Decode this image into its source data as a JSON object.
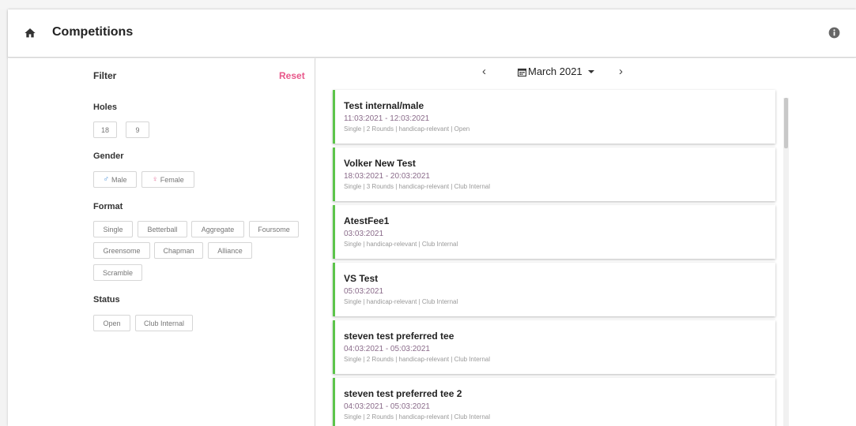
{
  "header": {
    "title": "Competitions",
    "home_icon": "home-icon",
    "info_icon": "info-icon"
  },
  "filter": {
    "title": "Filter",
    "reset_label": "Reset",
    "holes": {
      "label": "Holes",
      "options": [
        "18",
        "9"
      ]
    },
    "gender": {
      "label": "Gender",
      "options": [
        "Male",
        "Female"
      ],
      "icons": [
        "male-symbol-icon",
        "female-symbol-icon"
      ]
    },
    "format": {
      "label": "Format",
      "options": [
        "Single",
        "Betterball",
        "Aggregate",
        "Foursome",
        "Greensome",
        "Chapman",
        "Alliance",
        "Scramble"
      ]
    },
    "status": {
      "label": "Status",
      "options": [
        "Open",
        "Club Internal"
      ]
    }
  },
  "calendar": {
    "month_label": "March 2021",
    "prev_symbol": "‹",
    "next_symbol": "›",
    "calendar_icon": "calendar-icon",
    "caret_icon": "caret-down-icon"
  },
  "competitions": [
    {
      "title": "Test internal/male",
      "dates": "11:03:2021 - 12:03:2021",
      "meta": "Single | 2 Rounds | handicap-relevant | Open"
    },
    {
      "title": "Volker New Test",
      "dates": "18:03:2021 - 20:03:2021",
      "meta": "Single | 3 Rounds | handicap-relevant | Club Internal"
    },
    {
      "title": "AtestFee1",
      "dates": "03:03:2021",
      "meta": "Single | handicap-relevant | Club Internal"
    },
    {
      "title": "VS Test",
      "dates": "05:03:2021",
      "meta": "Single | handicap-relevant | Club Internal"
    },
    {
      "title": "steven test preferred tee",
      "dates": "04:03:2021 - 05:03:2021",
      "meta": "Single | 2 Rounds | handicap-relevant | Club Internal"
    },
    {
      "title": "steven test preferred tee 2",
      "dates": "04:03:2021 - 05:03:2021",
      "meta": "Single | 2 Rounds | handicap-relevant | Club Internal"
    }
  ],
  "colors": {
    "accent_pink": "#e8578a",
    "card_border_green": "#5cc44a",
    "male_blue": "#4a90d9",
    "female_pink": "#e36b96"
  }
}
